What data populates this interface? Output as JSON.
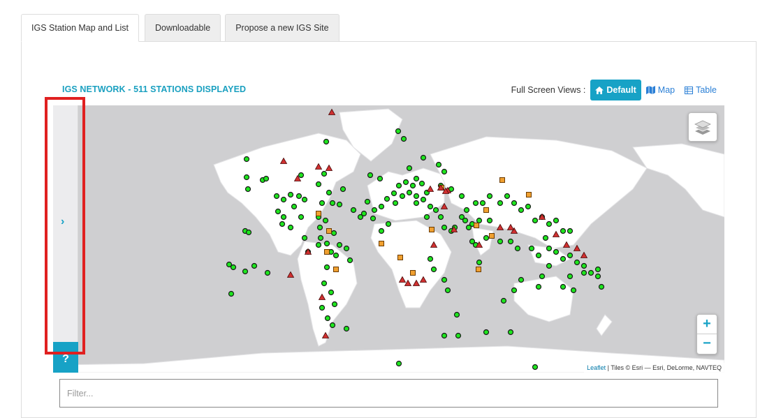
{
  "tabs": [
    {
      "label": "IGS Station Map and List",
      "active": true
    },
    {
      "label": "Downloadable",
      "active": false
    },
    {
      "label": "Propose a new IGS Site",
      "active": false
    }
  ],
  "network_title": "IGS NETWORK - 511 STATIONS DISPLAYED",
  "views": {
    "label": "Full Screen Views :",
    "default_label": "Default",
    "map_label": "Map",
    "table_label": "Table"
  },
  "map": {
    "zoom_in": "+",
    "zoom_out": "−",
    "attribution_link": "Leaflet",
    "attribution_text": " | Tiles © Esri — Esri, DeLorme, NAVTEQ",
    "layers_icon": "layers-icon",
    "colors": {
      "land": "#ffffff",
      "water": "#cfcfd1",
      "station_active": "#1ee61e",
      "station_warning": "#f0a030",
      "station_problem": "#d03030"
    }
  },
  "sidebar": {
    "toggle_icon": "chevron-right-icon",
    "help_label": "?"
  },
  "filter": {
    "placeholder": "Filter...",
    "value": ""
  },
  "accent_color": "#17a2c6"
}
